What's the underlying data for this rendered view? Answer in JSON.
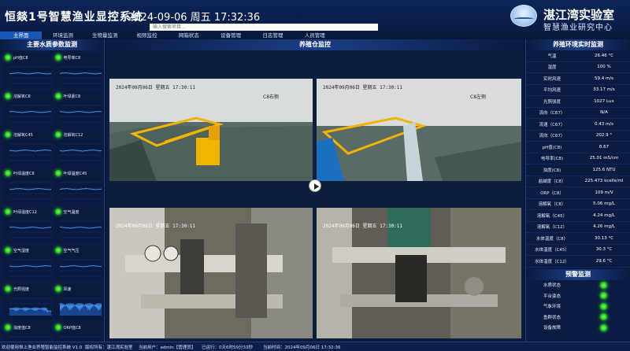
{
  "header": {
    "title": "恒燚1号智慧渔业显控系统",
    "datetime": "2024-09-06 周五 17:32:36",
    "search_placeholder": "输入搜索项目...",
    "lab_name": "湛江湾实验室",
    "lab_sub": "智慧渔业研究中心"
  },
  "nav": [
    "主界面",
    "环境监测",
    "生物量监测",
    "视频监控",
    "网箱状态",
    "设备管理",
    "日志管理",
    "人员管理",
    "",
    "",
    "",
    "",
    "",
    "",
    ""
  ],
  "left_panel": {
    "title": "主要水质参数监测",
    "sensors": [
      "pH值C8",
      "电导率C8",
      "溶解氧C8",
      "叶绿素C8",
      "溶解氧C45",
      "溶解氧C12",
      "叶绿温度C8",
      "叶绿温度C45",
      "叶绿温度C12",
      "空气温度",
      "空气湿度",
      "空气气压",
      "光照强度",
      "风速",
      "浊度值C8",
      "ORP值C8"
    ]
  },
  "center": {
    "title": "养殖仓监控",
    "videos": [
      {
        "timestamp": "2024年09月06日 星期五 17:30:11",
        "camera": "C8右侧"
      },
      {
        "timestamp": "2024年09月06日 星期五 17:30:11",
        "camera": "C8左侧"
      },
      {
        "timestamp": "2024年09月06日 星期五 17:30:11",
        "camera": ""
      },
      {
        "timestamp": "2024年09月06日 星期五 17:30:11",
        "camera": ""
      }
    ]
  },
  "right_panel": {
    "title": "养殖环境实时监测",
    "env": [
      {
        "k": "气温",
        "v": "26.46 °C"
      },
      {
        "k": "湿度",
        "v": "100 %"
      },
      {
        "k": "实时风速",
        "v": "59.4 m/s"
      },
      {
        "k": "平均风速",
        "v": "33.17 m/s"
      },
      {
        "k": "光照强度",
        "v": "1027 Lux"
      },
      {
        "k": "流向（C67）",
        "v": "N/A"
      },
      {
        "k": "流速（C67）",
        "v": "0.43 m/s"
      },
      {
        "k": "流向（C67）",
        "v": "202.9 °"
      },
      {
        "k": "pH值(C8)",
        "v": "8.67"
      },
      {
        "k": "电导率(C8)",
        "v": "25.01 mS/cm"
      },
      {
        "k": "浊度(C8)",
        "v": "125.6 NTU"
      },
      {
        "k": "盐碱度（C8）",
        "v": "225.473 kcells/ml"
      },
      {
        "k": "ORP（C8）",
        "v": "109 m/V"
      },
      {
        "k": "溶解氧（C8）",
        "v": "5.06 mg/L"
      },
      {
        "k": "溶解氧（C45）",
        "v": "4.24 mg/L"
      },
      {
        "k": "溶解氧（C12）",
        "v": "4.26 mg/L"
      },
      {
        "k": "水体温度（C8）",
        "v": "30.13 °C"
      },
      {
        "k": "水体温度（C45）",
        "v": "30.3 °C"
      },
      {
        "k": "水体温度（C12）",
        "v": "29.6 °C"
      }
    ],
    "alarm_title": "预警监测",
    "alarms": [
      "水质状态",
      "平台姿态",
      "气象环境",
      "鱼群状态",
      "设备故障"
    ]
  },
  "footer": {
    "welcome": "欢迎使用恒上渔业养殖智能监控系统 V1.0",
    "copyright": "版权所有：湛江湾实验室",
    "user": "当前用户：admin【管理员】",
    "uptime": "已运行：0天6时59分33秒",
    "time": "当前时间：2024年09月06日 17:32:36"
  },
  "colors": {
    "background": "#0a1a3e",
    "nav_active": "#1a56b6",
    "status_green": "#25c21b"
  }
}
